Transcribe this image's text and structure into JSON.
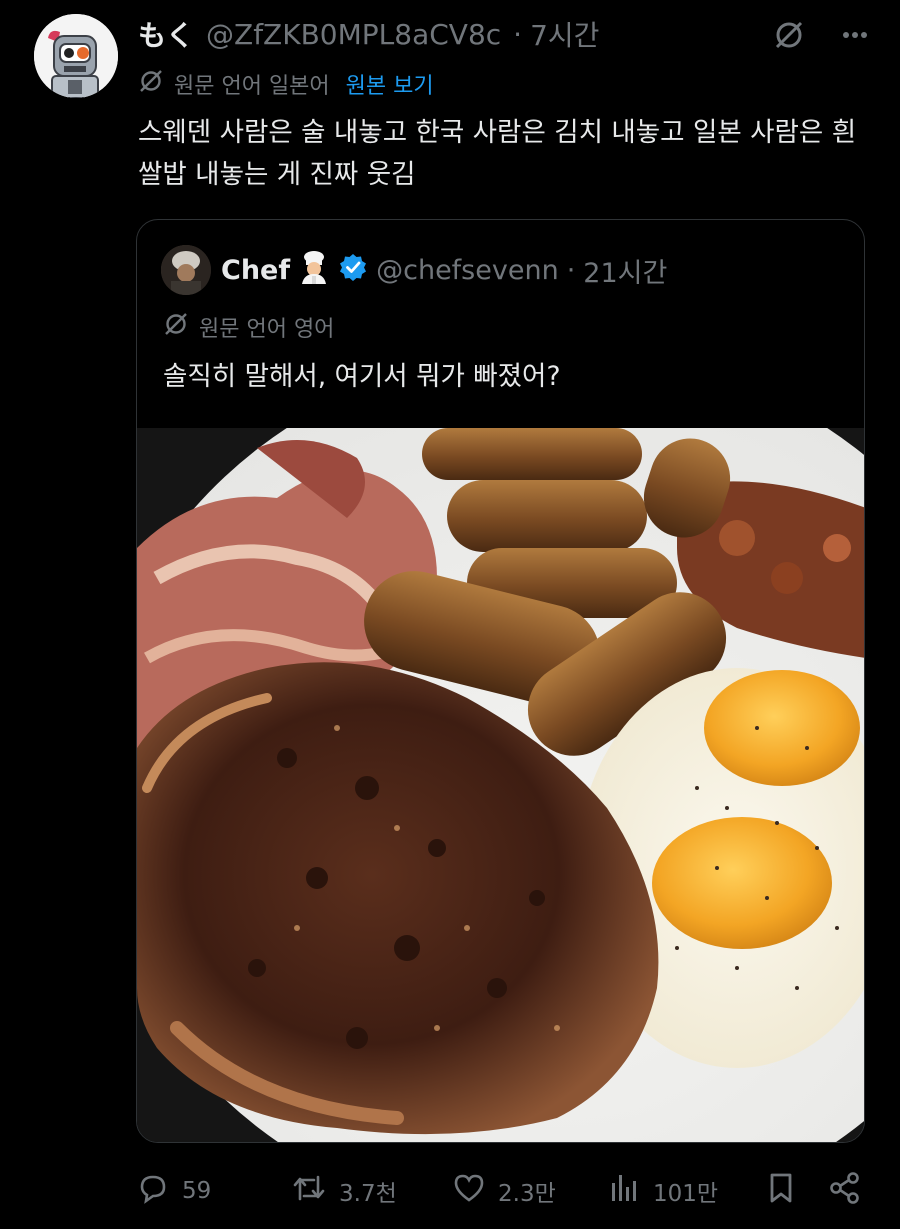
{
  "author": {
    "display_name": "もく",
    "handle": "@ZfZKB0MPL8aCV8c",
    "separator": "·",
    "time": "7시간"
  },
  "translation": {
    "label": "원문 언어 일본어",
    "link": "원본 보기"
  },
  "tweet": {
    "text": "스웨덴 사람은 술 내놓고 한국 사람은 김치 내놓고 일본 사람은 흰쌀밥 내놓는 게 진짜 웃김"
  },
  "quote": {
    "display_name": "Chef",
    "emoji": "👨‍🍳",
    "handle": "@chefsevenn",
    "separator": "·",
    "time": "21시간",
    "translation_label": "원문 언어 영어",
    "text": "솔직히 말해서, 여기서 뭐가 빠졌어?"
  },
  "icons": {
    "translate": "translate-icon",
    "more": "more-icon",
    "reply": "reply-icon",
    "retweet": "retweet-icon",
    "like": "like-icon",
    "views": "views-icon",
    "bookmark": "bookmark-icon",
    "share": "share-icon",
    "verified": "verified-badge-icon"
  },
  "actions": {
    "replies": "59",
    "retweets": "3.7천",
    "likes": "2.3만",
    "views": "101만"
  },
  "colors": {
    "background": "#000000",
    "text": "#e7e9ea",
    "muted": "#71767b",
    "link": "#1d9bf0",
    "border": "#2f3336"
  }
}
